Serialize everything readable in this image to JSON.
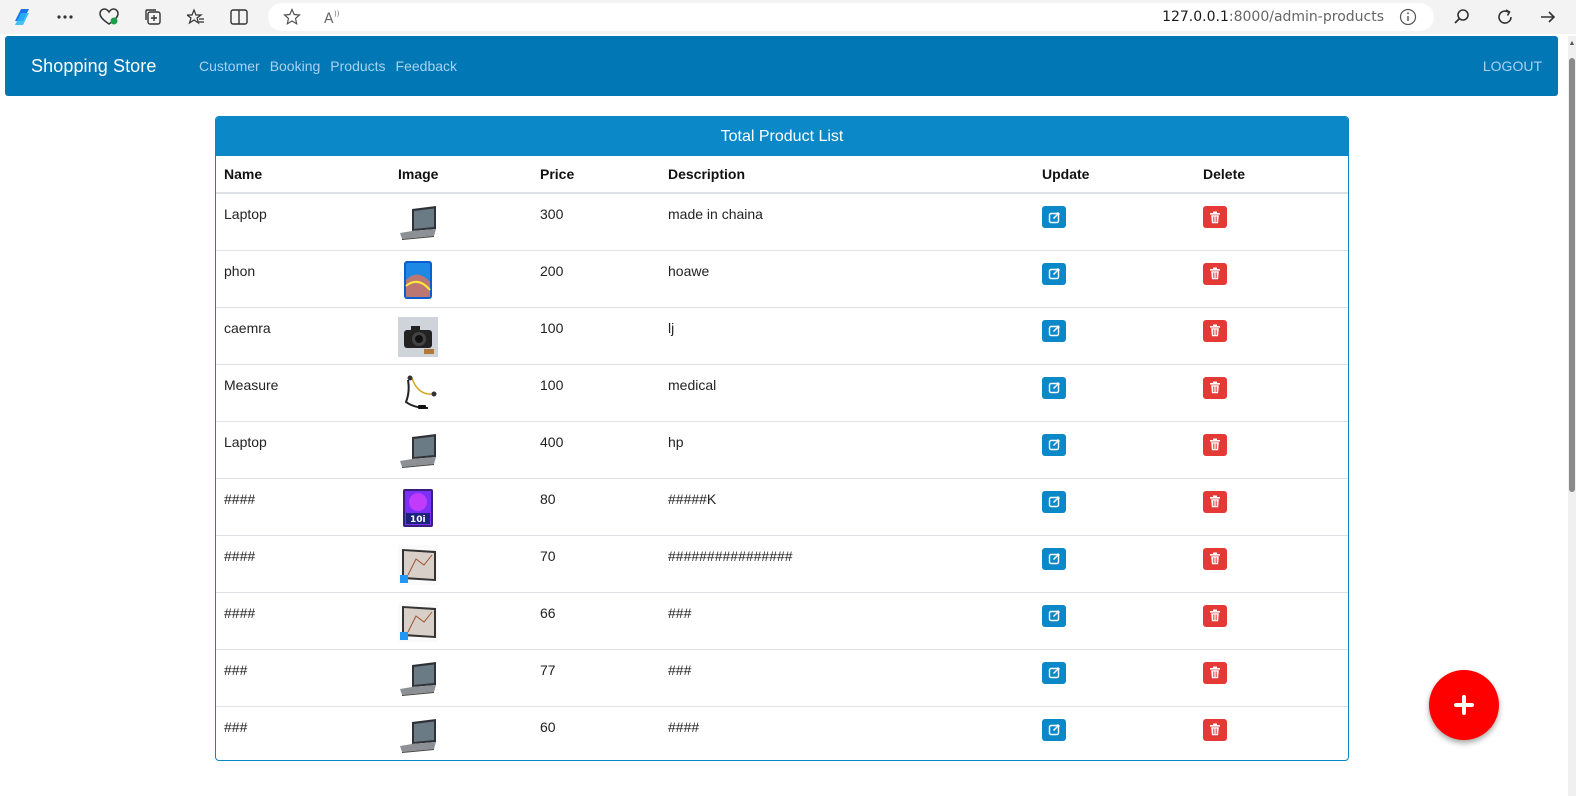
{
  "browser": {
    "url_host": "127.0.0.1",
    "url_rest": ":8000/admin-products"
  },
  "navbar": {
    "brand": "Shopping Store",
    "links": [
      "Customer",
      "Booking",
      "Products",
      "Feedback"
    ],
    "logout": "LOGOUT"
  },
  "card": {
    "title": "Total Product List",
    "columns": [
      "Name",
      "Image",
      "Price",
      "Description",
      "Update",
      "Delete"
    ],
    "rows": [
      {
        "name": "Laptop",
        "image": "laptop",
        "price": "300",
        "description": "made in chaina"
      },
      {
        "name": "phon",
        "image": "phone",
        "price": "200",
        "description": "hoawe"
      },
      {
        "name": "caemra",
        "image": "camera",
        "price": "100",
        "description": "lj"
      },
      {
        "name": "Measure",
        "image": "earphones",
        "price": "100",
        "description": "medical"
      },
      {
        "name": "Laptop",
        "image": "laptop",
        "price": "400",
        "description": "hp"
      },
      {
        "name": "####",
        "image": "tablet-10i",
        "price": "80",
        "description": "#####K"
      },
      {
        "name": "####",
        "image": "tablet-stand",
        "price": "70",
        "description": "################"
      },
      {
        "name": "####",
        "image": "tablet-stand",
        "price": "66",
        "description": "###"
      },
      {
        "name": "###",
        "image": "laptop",
        "price": "77",
        "description": "###"
      },
      {
        "name": "###",
        "image": "laptop",
        "price": "60",
        "description": "####"
      }
    ]
  },
  "colors": {
    "navbar": "#0277b6",
    "card_header": "#0a88c8",
    "edit_button": "#0a88c8",
    "delete_button": "#e53935",
    "fab": "#ff0000"
  },
  "icons": {
    "edit": "edit-icon",
    "delete": "trash-icon",
    "fab": "plus-icon"
  }
}
